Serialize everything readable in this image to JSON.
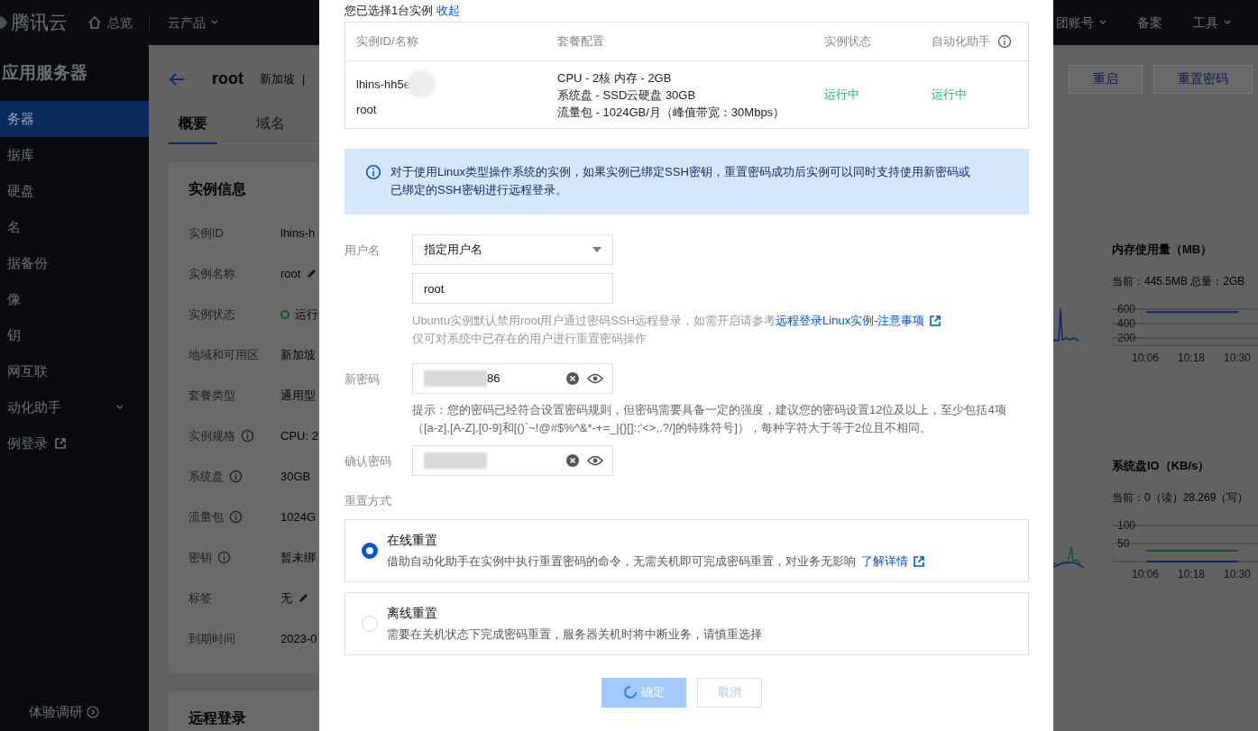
{
  "top_nav": {
    "logo": "腾讯云",
    "items": [
      {
        "label": "总览",
        "kind": "home"
      },
      {
        "label": "云产品",
        "kind": "dropdown"
      }
    ],
    "right_items": [
      {
        "label": "团账号",
        "kind": "dropdown"
      },
      {
        "label": "备案",
        "kind": "plain"
      },
      {
        "label": "工具",
        "kind": "dropdown"
      }
    ]
  },
  "sidebar": {
    "title": "应用服务器",
    "items": [
      {
        "label": "务器",
        "selected": true,
        "kind": "plain"
      },
      {
        "label": "据库",
        "selected": false,
        "kind": "plain"
      },
      {
        "label": "硬盘",
        "selected": false,
        "kind": "plain"
      },
      {
        "label": "名",
        "selected": false,
        "kind": "plain"
      },
      {
        "label": "据备份",
        "selected": false,
        "kind": "plain"
      },
      {
        "label": "像",
        "selected": false,
        "kind": "plain"
      },
      {
        "label": "钥",
        "selected": false,
        "kind": "plain"
      },
      {
        "label": "网互联",
        "selected": false,
        "kind": "plain"
      },
      {
        "label": "动化助手",
        "selected": false,
        "kind": "expandable"
      },
      {
        "label": "例登录",
        "selected": false,
        "kind": "external"
      }
    ],
    "footer": "体验调研"
  },
  "page_header": {
    "title": "root",
    "region": "新加坡",
    "separator": "|"
  },
  "tabs": [
    {
      "label": "概要",
      "selected": true
    },
    {
      "label": "域名",
      "selected": false
    }
  ],
  "toolbar_buttons": [
    "重启",
    "重置密码"
  ],
  "instance_info": {
    "title": "实例信息",
    "rows": [
      {
        "label": "实例ID",
        "info_icon": false,
        "kind": "text",
        "value": "lhins-h"
      },
      {
        "label": "实例名称",
        "info_icon": false,
        "kind": "editable",
        "value": "root"
      },
      {
        "label": "实例状态",
        "info_icon": false,
        "kind": "status",
        "value": "运行"
      },
      {
        "label": "地域和可用区",
        "info_icon": false,
        "kind": "text",
        "value": "新加坡"
      },
      {
        "label": "套餐类型",
        "info_icon": false,
        "kind": "text",
        "value": "通用型"
      },
      {
        "label": "实例规格",
        "info_icon": true,
        "kind": "text",
        "value": "CPU: 2"
      },
      {
        "label": "系统盘",
        "info_icon": true,
        "kind": "text",
        "value": "30GB"
      },
      {
        "label": "流量包",
        "info_icon": true,
        "kind": "text",
        "value": "1024G"
      },
      {
        "label": "密钥",
        "info_icon": true,
        "kind": "text",
        "value": "暂未绑"
      },
      {
        "label": "标签",
        "info_icon": false,
        "kind": "editable",
        "value": "无"
      },
      {
        "label": "到期时间",
        "info_icon": false,
        "kind": "text",
        "value": "2023-0"
      }
    ]
  },
  "remote_login": {
    "title": "远程登录"
  },
  "metrics": [
    {
      "title": "内存使用量（MB）",
      "summary": "当前：445.5MB 总量：2GB",
      "chart_data": {
        "type": "line",
        "categories": [
          "10:06",
          "10:18",
          "10:30"
        ],
        "yticks": [
          200,
          400,
          600
        ],
        "ylim": [
          100,
          650
        ],
        "grid": true,
        "series": [
          {
            "color": "#0e2a66",
            "values": [
              560,
              560,
              560
            ]
          }
        ]
      }
    },
    {
      "title": "系统盘IO（KB/s）",
      "summary": "当前：0（读）28.269（写）",
      "chart_data": {
        "type": "line",
        "categories": [
          "10:06",
          "10:18",
          "10:30"
        ],
        "yticks": [
          50,
          100
        ],
        "ylim": [
          0,
          110
        ],
        "grid": true,
        "series": [
          {
            "color": "#14532d",
            "values": [
              30,
              30,
              30
            ]
          },
          {
            "color": "#0e2a66",
            "values": [
              0,
              0,
              0
            ]
          }
        ]
      }
    }
  ],
  "modal": {
    "selection_text": "您已选择1台实例",
    "collapse_link": "收起",
    "table": {
      "columns": [
        {
          "label": "实例ID/名称",
          "info_icon": false
        },
        {
          "label": "套餐配置",
          "info_icon": false
        },
        {
          "label": "实例状态",
          "info_icon": false
        },
        {
          "label": "自动化助手",
          "info_icon": true
        }
      ],
      "rows": [
        {
          "id": "lhins-hh5e",
          "name": "root",
          "config": [
            "CPU - 2核 内存 - 2GB",
            "系统盘 - SSD云硬盘 30GB",
            "流量包 - 1024GB/月（峰值带宽：30Mbps）"
          ],
          "status": "运行中",
          "helper_status": "运行中"
        }
      ]
    },
    "notice": "对于使用Linux类型操作系统的实例，如果实例已绑定SSH密钥，重置密码成功后实例可以同时支持使用新密码或已绑定的SSH密钥进行远程登录。",
    "username": {
      "label": "用户名",
      "select": "指定用户名",
      "value": "root",
      "hint": "Ubuntu实例默认禁用root用户通过密码SSH远程登录，如需开启请参考",
      "hint_link": "远程登录Linux实例-注意事项",
      "hint2": "仅可对系统中已存在的用户进行重置密码操作"
    },
    "new_password": {
      "label": "新密码",
      "value": "86",
      "hint": "提示：您的密码已经符合设置密码规则，但密码需要具备一定的强度，建议您的密码设置12位及以上，至少包括4项（[a-z],[A-Z],[0-9]和[()`~!@#$%^&*-+=_|{}[]:;'<>,.?/]的特殊符号]），每种字符大于等于2位且不相同。"
    },
    "confirm_password": {
      "label": "确认密码"
    },
    "reset_method": {
      "label": "重置方式",
      "options": [
        {
          "title": "在线重置",
          "description": "借助自动化助手在实例中执行重置密码的命令，无需关机即可完成密码重置，对业务无影响",
          "link": "了解详情",
          "selected": true
        },
        {
          "title": "离线重置",
          "description": "需要在关机状态下完成密码重置，服务器关机时将中断业务，请慎重选择",
          "selected": false
        }
      ]
    },
    "buttons": [
      {
        "label": "确定",
        "kind": "primary",
        "loading": true
      },
      {
        "label": "取消",
        "kind": "secondary",
        "loading": false
      }
    ]
  }
}
